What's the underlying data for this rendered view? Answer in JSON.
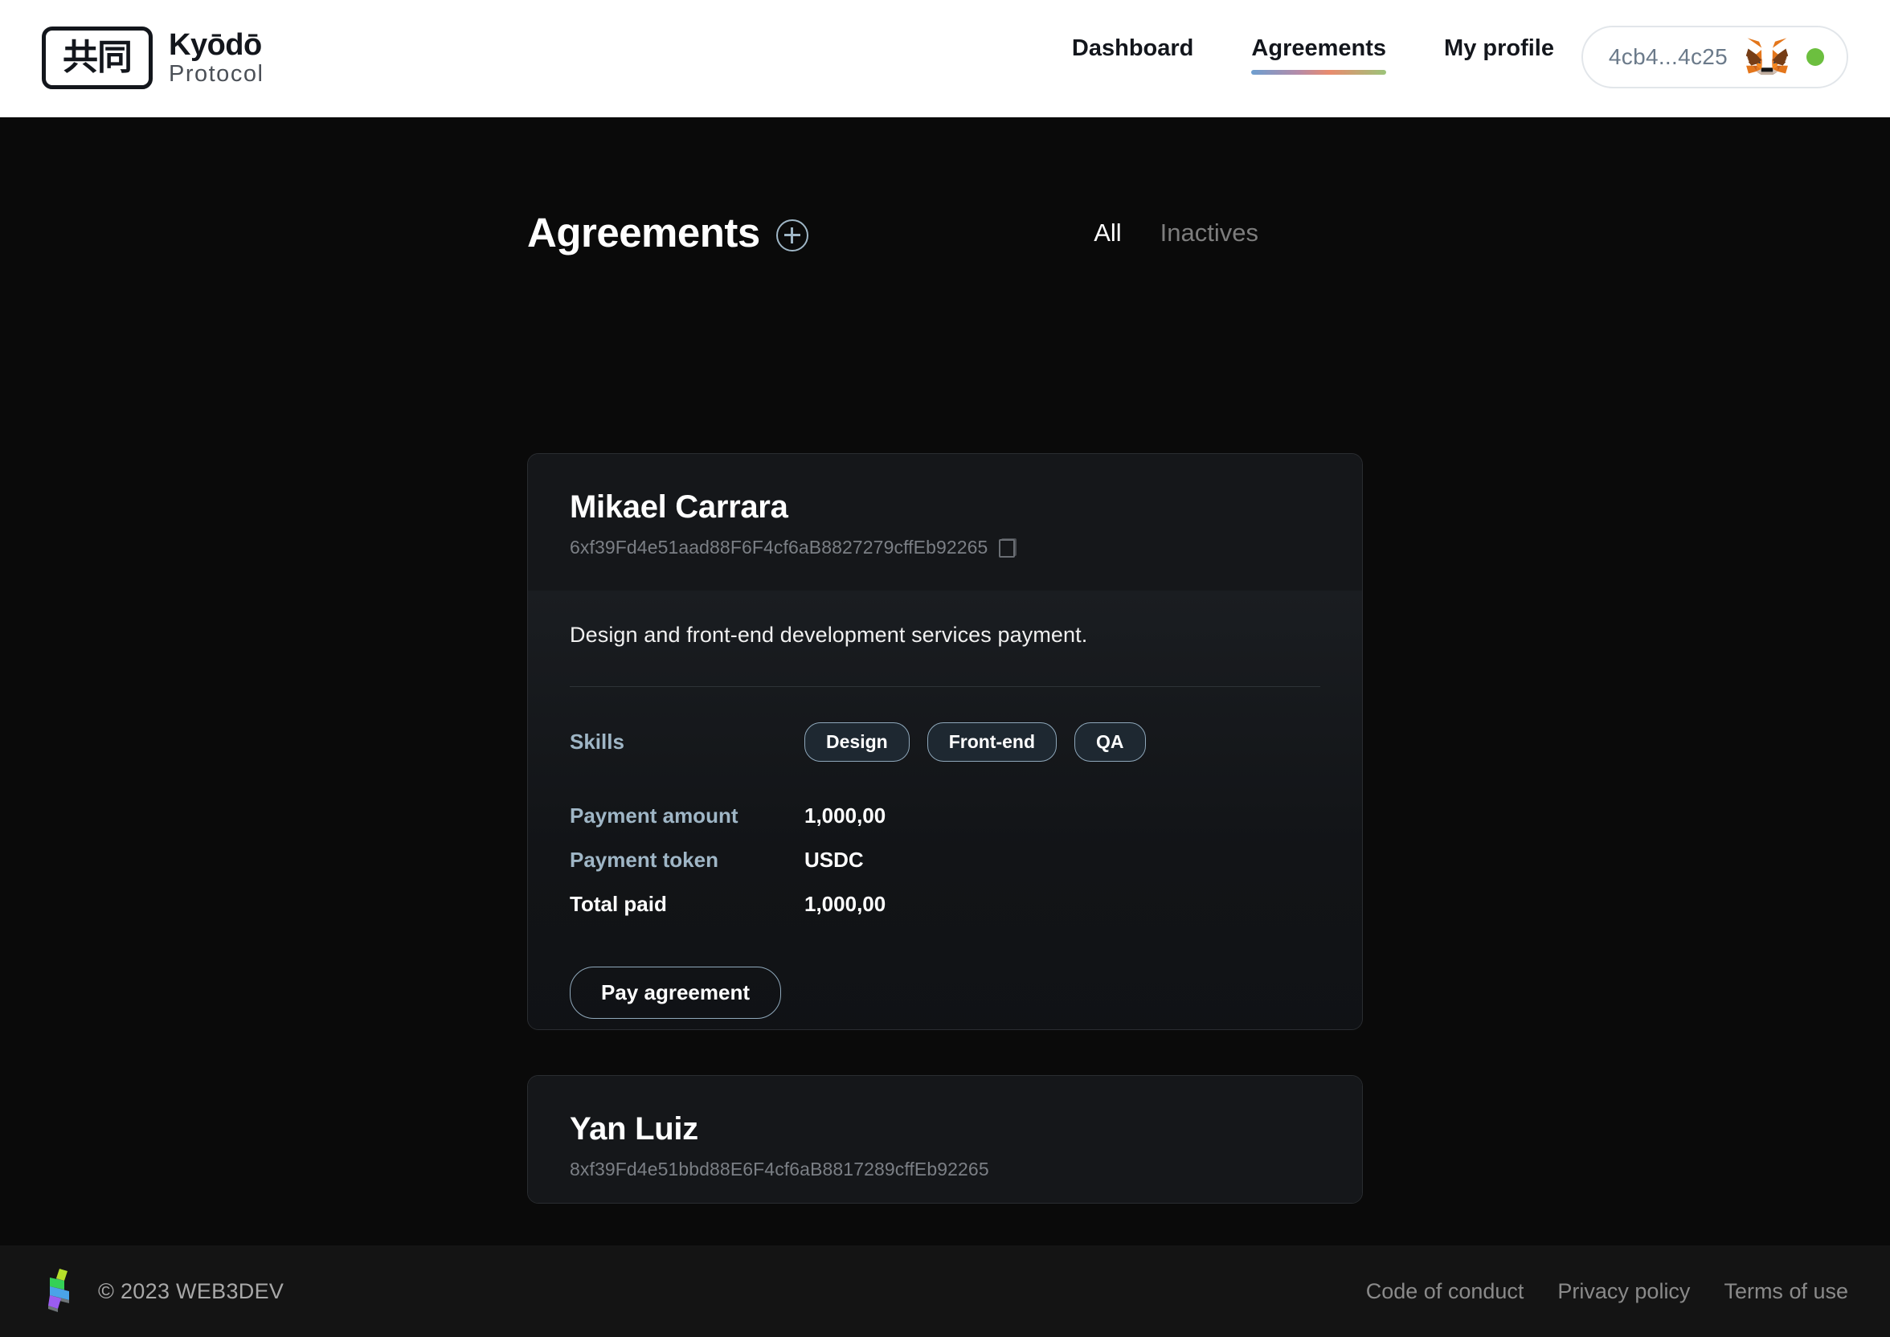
{
  "brand": {
    "mark": "共同",
    "title": "Kyōdō",
    "subtitle": "Protocol"
  },
  "nav": {
    "items": [
      {
        "label": "Dashboard",
        "active": false
      },
      {
        "label": "Agreements",
        "active": true
      },
      {
        "label": "My profile",
        "active": false
      }
    ],
    "wallet": {
      "address": "4cb4...4c25",
      "icon": "metamask-fox-icon",
      "status_color": "#6cbf3f"
    },
    "underline_gradient": "#6e9fd0 → #e98b6e → #9cc47a"
  },
  "page": {
    "title": "Agreements",
    "add_icon": "plus-circle-icon",
    "tabs": [
      {
        "label": "All",
        "active": true
      },
      {
        "label": "Inactives",
        "active": false
      }
    ]
  },
  "agreements": [
    {
      "name": "Mikael Carrara",
      "address": "6xf39Fd4e51aad88F6F4cf6aB8827279cffEb92265",
      "copy_icon": "copy-icon",
      "expanded": true,
      "description": "Design and front-end development services payment.",
      "skills_label": "Skills",
      "skills": [
        "Design",
        "Front-end",
        "QA"
      ],
      "details": [
        {
          "label": "Payment amount",
          "value": "1,000,00",
          "accent": true
        },
        {
          "label": "Payment token",
          "value": "USDC",
          "accent": true
        },
        {
          "label": "Total paid",
          "value": "1,000,00",
          "accent": false
        }
      ],
      "action_label": "Pay agreement"
    },
    {
      "name": "Yan Luiz",
      "address": "8xf39Fd4e51bbd88E6F4cf6aB8817289cffEb92265",
      "expanded": false
    }
  ],
  "footer": {
    "logo_icon": "web3dev-ribbon-logo",
    "copyright": "© 2023 WEB3DEV",
    "links": [
      "Code of conduct",
      "Privacy policy",
      "Terms of use"
    ]
  },
  "colors": {
    "background": "#0a0a0a",
    "header_bg": "#ffffff",
    "card_bg": "#141619",
    "accent_blue": "#9fb6c6",
    "text_primary": "#ffffff",
    "text_muted": "#7b7f85"
  }
}
